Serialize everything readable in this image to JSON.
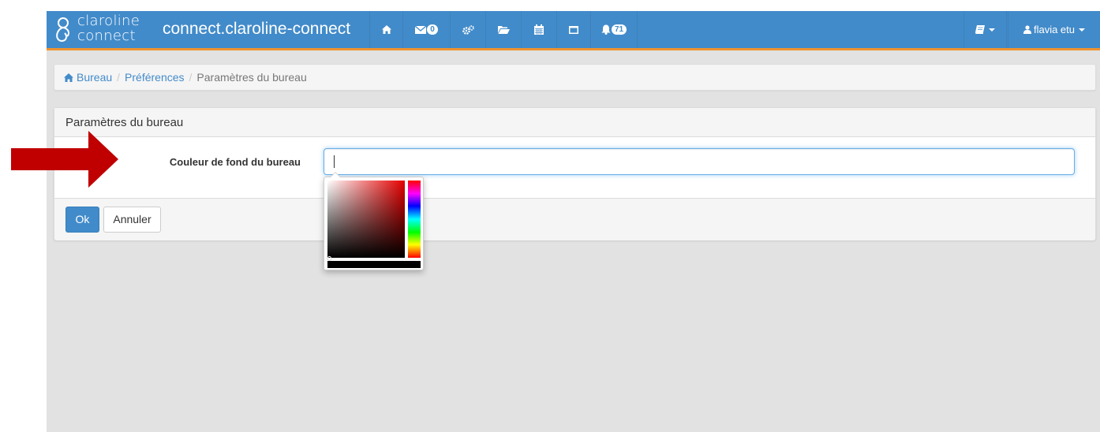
{
  "navbar": {
    "logo_line1": "claroline",
    "logo_line2": "connect",
    "site_title": "connect.claroline-connect",
    "icons": [
      "home-icon",
      "envelope-icon",
      "cogs-icon",
      "folder-open-icon",
      "calendar-icon",
      "desktop-icon",
      "bell-icon",
      "book-icon",
      "user-icon"
    ],
    "messages_badge": "0",
    "notifications_badge": "71",
    "user_name": "flavia etu",
    "color": "#428bca",
    "accent": "#f0932e"
  },
  "breadcrumb": {
    "items": [
      "Bureau",
      "Préférences",
      "Paramètres du bureau"
    ]
  },
  "panel": {
    "heading": "Paramètres du bureau",
    "field_label": "Couleur de fond du bureau",
    "field_value": "",
    "ok_label": "Ok",
    "cancel_label": "Annuler"
  },
  "colorpicker": {
    "hue_color": "#e60000",
    "preview_color": "#000000"
  },
  "annotation": {
    "arrow_color": "#c00000"
  }
}
